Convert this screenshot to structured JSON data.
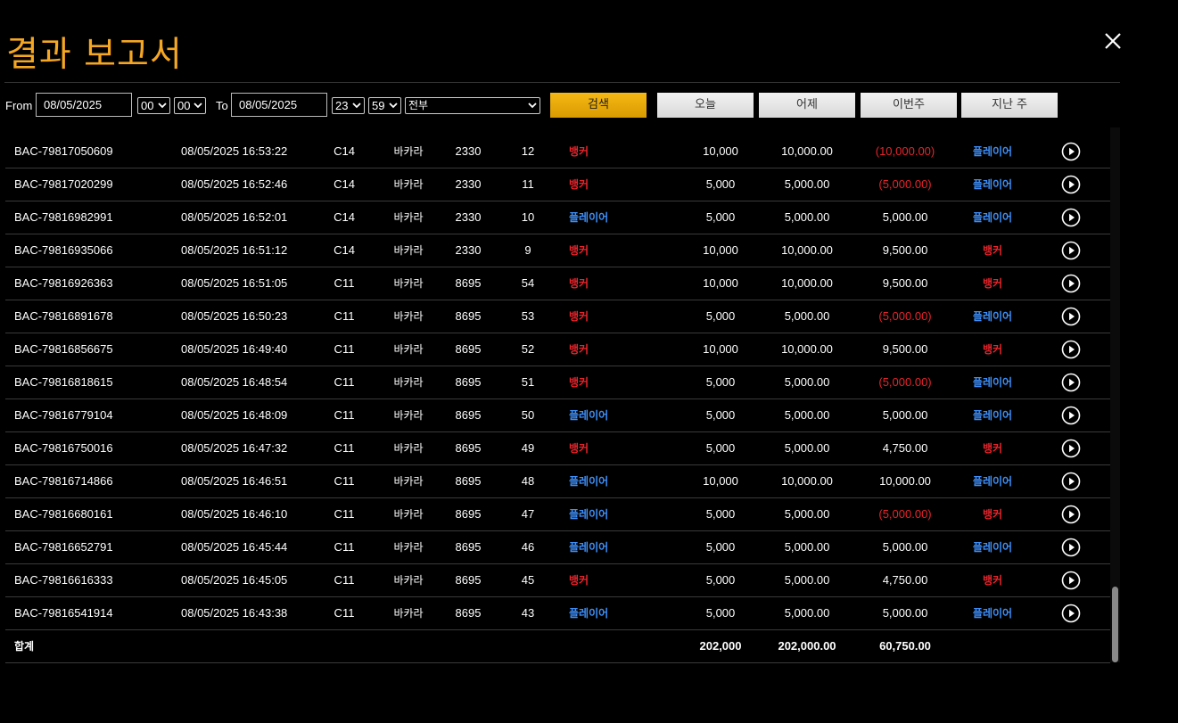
{
  "title": "결과 보고서",
  "filters": {
    "from_label": "From",
    "from_date": "08/05/2025",
    "from_hour": "00",
    "from_min": "00",
    "to_label": "To",
    "to_date": "08/05/2025",
    "to_hour": "23",
    "to_min": "59",
    "game_select": "전부",
    "search_label": "검색",
    "today_label": "오늘",
    "yesterday_label": "어제",
    "this_week_label": "이번주",
    "last_week_label": "지난 주"
  },
  "colors": {
    "accent": "#f5a623",
    "banker": "#e8242b",
    "player": "#3e8ef7",
    "loss": "#e8242b"
  },
  "rows": [
    {
      "id": "BAC-79817050609",
      "date": "08/05/2025 16:53:22",
      "table": "C14",
      "game": "바카라",
      "round": "2330",
      "hand": "12",
      "bet": "뱅커",
      "bet_type": "banker",
      "amount": "10,000",
      "valid": "10,000.00",
      "win": "(10,000.00)",
      "win_neg": true,
      "result": "플레이어",
      "result_type": "player"
    },
    {
      "id": "BAC-79817020299",
      "date": "08/05/2025 16:52:46",
      "table": "C14",
      "game": "바카라",
      "round": "2330",
      "hand": "11",
      "bet": "뱅커",
      "bet_type": "banker",
      "amount": "5,000",
      "valid": "5,000.00",
      "win": "(5,000.00)",
      "win_neg": true,
      "result": "플레이어",
      "result_type": "player"
    },
    {
      "id": "BAC-79816982991",
      "date": "08/05/2025 16:52:01",
      "table": "C14",
      "game": "바카라",
      "round": "2330",
      "hand": "10",
      "bet": "플레이어",
      "bet_type": "player",
      "amount": "5,000",
      "valid": "5,000.00",
      "win": "5,000.00",
      "win_neg": false,
      "result": "플레이어",
      "result_type": "player"
    },
    {
      "id": "BAC-79816935066",
      "date": "08/05/2025 16:51:12",
      "table": "C14",
      "game": "바카라",
      "round": "2330",
      "hand": "9",
      "bet": "뱅커",
      "bet_type": "banker",
      "amount": "10,000",
      "valid": "10,000.00",
      "win": "9,500.00",
      "win_neg": false,
      "result": "뱅커",
      "result_type": "banker"
    },
    {
      "id": "BAC-79816926363",
      "date": "08/05/2025 16:51:05",
      "table": "C11",
      "game": "바카라",
      "round": "8695",
      "hand": "54",
      "bet": "뱅커",
      "bet_type": "banker",
      "amount": "10,000",
      "valid": "10,000.00",
      "win": "9,500.00",
      "win_neg": false,
      "result": "뱅커",
      "result_type": "banker"
    },
    {
      "id": "BAC-79816891678",
      "date": "08/05/2025 16:50:23",
      "table": "C11",
      "game": "바카라",
      "round": "8695",
      "hand": "53",
      "bet": "뱅커",
      "bet_type": "banker",
      "amount": "5,000",
      "valid": "5,000.00",
      "win": "(5,000.00)",
      "win_neg": true,
      "result": "플레이어",
      "result_type": "player"
    },
    {
      "id": "BAC-79816856675",
      "date": "08/05/2025 16:49:40",
      "table": "C11",
      "game": "바카라",
      "round": "8695",
      "hand": "52",
      "bet": "뱅커",
      "bet_type": "banker",
      "amount": "10,000",
      "valid": "10,000.00",
      "win": "9,500.00",
      "win_neg": false,
      "result": "뱅커",
      "result_type": "banker"
    },
    {
      "id": "BAC-79816818615",
      "date": "08/05/2025 16:48:54",
      "table": "C11",
      "game": "바카라",
      "round": "8695",
      "hand": "51",
      "bet": "뱅커",
      "bet_type": "banker",
      "amount": "5,000",
      "valid": "5,000.00",
      "win": "(5,000.00)",
      "win_neg": true,
      "result": "플레이어",
      "result_type": "player"
    },
    {
      "id": "BAC-79816779104",
      "date": "08/05/2025 16:48:09",
      "table": "C11",
      "game": "바카라",
      "round": "8695",
      "hand": "50",
      "bet": "플레이어",
      "bet_type": "player",
      "amount": "5,000",
      "valid": "5,000.00",
      "win": "5,000.00",
      "win_neg": false,
      "result": "플레이어",
      "result_type": "player"
    },
    {
      "id": "BAC-79816750016",
      "date": "08/05/2025 16:47:32",
      "table": "C11",
      "game": "바카라",
      "round": "8695",
      "hand": "49",
      "bet": "뱅커",
      "bet_type": "banker",
      "amount": "5,000",
      "valid": "5,000.00",
      "win": "4,750.00",
      "win_neg": false,
      "result": "뱅커",
      "result_type": "banker"
    },
    {
      "id": "BAC-79816714866",
      "date": "08/05/2025 16:46:51",
      "table": "C11",
      "game": "바카라",
      "round": "8695",
      "hand": "48",
      "bet": "플레이어",
      "bet_type": "player",
      "amount": "10,000",
      "valid": "10,000.00",
      "win": "10,000.00",
      "win_neg": false,
      "result": "플레이어",
      "result_type": "player"
    },
    {
      "id": "BAC-79816680161",
      "date": "08/05/2025 16:46:10",
      "table": "C11",
      "game": "바카라",
      "round": "8695",
      "hand": "47",
      "bet": "플레이어",
      "bet_type": "player",
      "amount": "5,000",
      "valid": "5,000.00",
      "win": "(5,000.00)",
      "win_neg": true,
      "result": "뱅커",
      "result_type": "banker"
    },
    {
      "id": "BAC-79816652791",
      "date": "08/05/2025 16:45:44",
      "table": "C11",
      "game": "바카라",
      "round": "8695",
      "hand": "46",
      "bet": "플레이어",
      "bet_type": "player",
      "amount": "5,000",
      "valid": "5,000.00",
      "win": "5,000.00",
      "win_neg": false,
      "result": "플레이어",
      "result_type": "player"
    },
    {
      "id": "BAC-79816616333",
      "date": "08/05/2025 16:45:05",
      "table": "C11",
      "game": "바카라",
      "round": "8695",
      "hand": "45",
      "bet": "뱅커",
      "bet_type": "banker",
      "amount": "5,000",
      "valid": "5,000.00",
      "win": "4,750.00",
      "win_neg": false,
      "result": "뱅커",
      "result_type": "banker"
    },
    {
      "id": "BAC-79816541914",
      "date": "08/05/2025 16:43:38",
      "table": "C11",
      "game": "바카라",
      "round": "8695",
      "hand": "43",
      "bet": "플레이어",
      "bet_type": "player",
      "amount": "5,000",
      "valid": "5,000.00",
      "win": "5,000.00",
      "win_neg": false,
      "result": "플레이어",
      "result_type": "player"
    }
  ],
  "summary": {
    "label": "합계",
    "amount": "202,000",
    "valid": "202,000.00",
    "win": "60,750.00"
  }
}
